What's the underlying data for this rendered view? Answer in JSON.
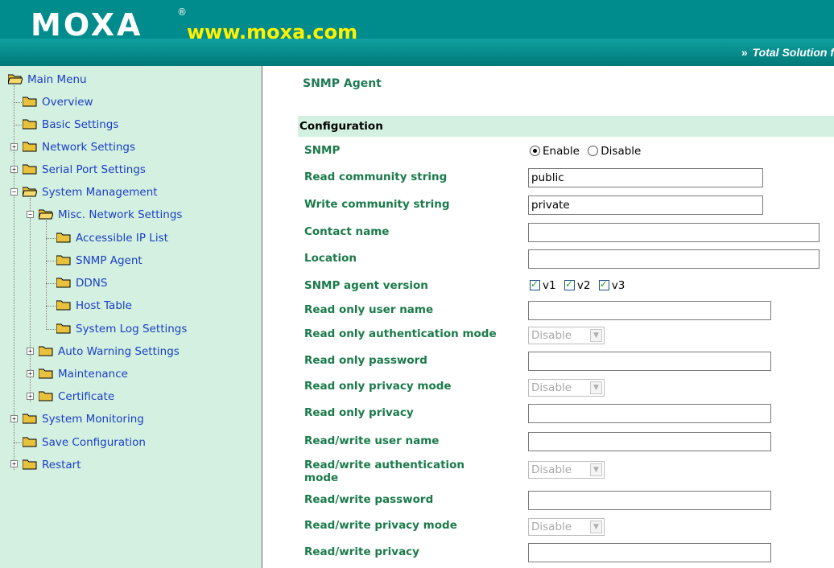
{
  "header": {
    "logo_text": "MOXA",
    "logo_reg": "®",
    "url": "www.moxa.com",
    "tagline_arrows": "»",
    "tagline": "Total Solution f",
    "colors": {
      "header_bg": "#008c8c",
      "url_color": "#fff200"
    }
  },
  "sidebar": {
    "root": "Main Menu",
    "items": [
      "Overview",
      "Basic Settings",
      "Network Settings",
      "Serial Port Settings",
      "System Management",
      "Misc. Network Settings",
      "Accessible IP List",
      "SNMP Agent",
      "DDNS",
      "Host Table",
      "System Log Settings",
      "Auto Warning Settings",
      "Maintenance",
      "Certificate",
      "System Monitoring",
      "Save Configuration",
      "Restart"
    ]
  },
  "main": {
    "title": "SNMP Agent",
    "section": "Configuration",
    "labels": {
      "snmp": "SNMP",
      "read_community": "Read community string",
      "write_community": "Write community string",
      "contact": "Contact name",
      "location": "Location",
      "agent_version": "SNMP agent version",
      "ro_user": "Read only user name",
      "ro_auth_mode": "Read only authentication mode",
      "ro_password": "Read only password",
      "ro_priv_mode": "Read only privacy mode",
      "ro_priv": "Read only privacy",
      "rw_user": "Read/write user name",
      "rw_auth_mode_1": "Read/write authentication",
      "rw_auth_mode_2": "mode",
      "rw_password": "Read/write password",
      "rw_priv_mode": "Read/write privacy mode",
      "rw_priv": "Read/write privacy"
    },
    "snmp_options": {
      "enable": "Enable",
      "disable": "Disable",
      "selected": "Enable"
    },
    "values": {
      "read_community": "public",
      "write_community": "private",
      "contact": "",
      "location": "",
      "ro_user": "",
      "ro_password": "",
      "ro_priv": "",
      "rw_user": "",
      "rw_password": "",
      "rw_priv": ""
    },
    "versions": {
      "v1": "v1",
      "v2": "v2",
      "v3": "v3"
    },
    "selects": {
      "ro_auth_mode": "Disable",
      "ro_priv_mode": "Disable",
      "rw_auth_mode": "Disable",
      "rw_priv_mode": "Disable"
    }
  }
}
